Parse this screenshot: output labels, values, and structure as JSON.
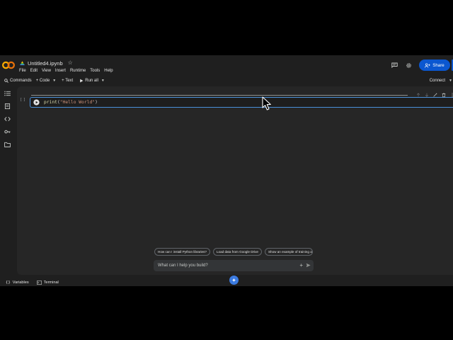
{
  "header": {
    "notebook_title": "Untitled4.ipynb",
    "menu": [
      "File",
      "Edit",
      "View",
      "Insert",
      "Runtime",
      "Tools",
      "Help"
    ],
    "share_label": "Share"
  },
  "toolbar": {
    "commands_label": "Commands",
    "code_label": "+ Code",
    "text_label": "+ Text",
    "run_all_label": "Run all",
    "connect_label": "Connect"
  },
  "cell": {
    "prompt": "[ ]",
    "code_fn": "print",
    "code_open": "(",
    "code_string": "\"Hello World\"",
    "code_close": ")"
  },
  "suggestions": [
    "How can I install Python libraries?",
    "Load data from Google Drive",
    "Show an example of training a"
  ],
  "prompt_box": {
    "placeholder": "What can I help you build?"
  },
  "statusbar": {
    "variables_label": "Variables",
    "terminal_label": "Terminal"
  },
  "colors": {
    "accent": "#0b57d0",
    "cell_border": "#4a90d9",
    "background": "#1f1f1f"
  }
}
